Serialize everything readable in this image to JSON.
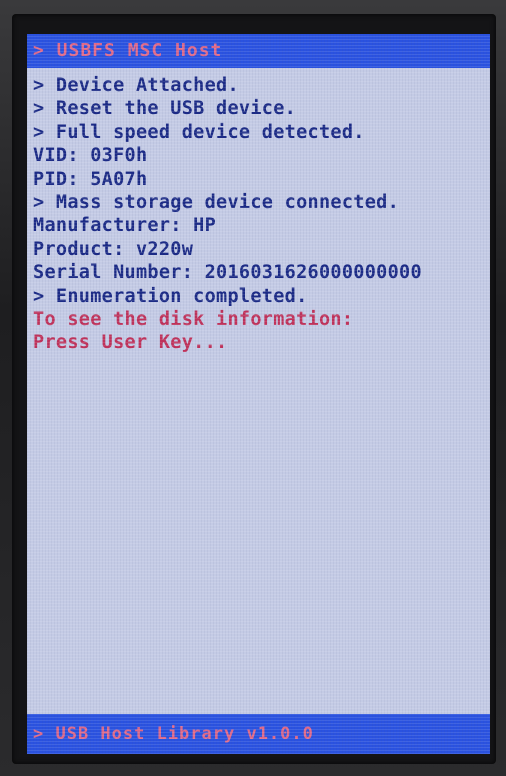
{
  "header": {
    "title": "> USBFS MSC Host"
  },
  "log": {
    "lines": [
      "> Device Attached.",
      "> Reset the USB device.",
      "> Full speed device detected.",
      "VID: 03F0h",
      "PID: 5A07h",
      "> Mass storage device connected.",
      "Manufacturer: HP",
      "Product: v220w",
      "Serial Number: 2016031626000000000",
      "> Enumeration completed."
    ],
    "prompt_lines": [
      "To see the disk information:",
      "Press User Key..."
    ]
  },
  "footer": {
    "text": "> USB Host Library v1.0.0"
  },
  "colors": {
    "bar_blue": "#2a52e0",
    "screen_bg": "#c4cbe5",
    "text_blue": "#1b2a86",
    "text_red": "#c0325a",
    "bar_text_pink": "#e06a8a"
  }
}
